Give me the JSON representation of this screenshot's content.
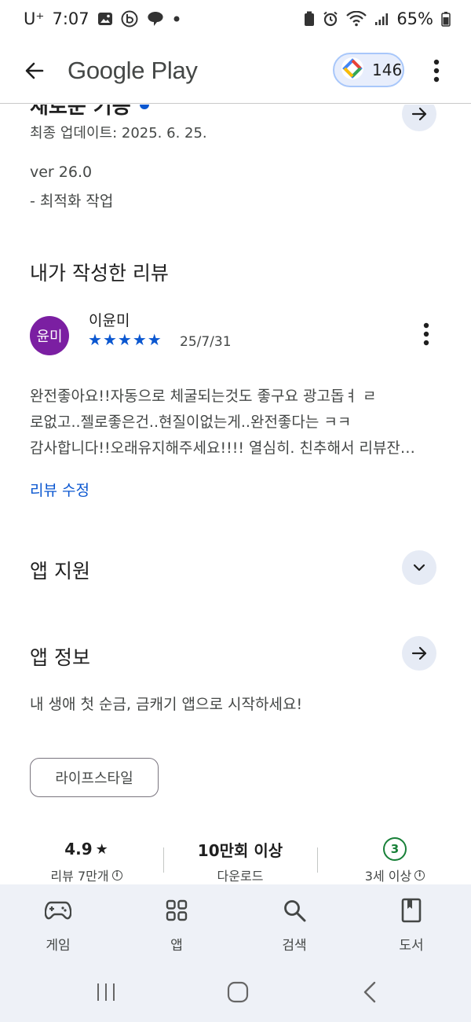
{
  "status_bar": {
    "carrier": "U⁺",
    "time": "7:07",
    "battery": "65%"
  },
  "app_bar": {
    "title": "Google Play",
    "points": "146"
  },
  "whats_new": {
    "title_partial": "새로운 기능",
    "last_updated": "최종 업데이트: 2025. 6. 25.",
    "version": "ver 26.0",
    "note": "- 최적화 작업"
  },
  "my_review": {
    "section_title": "내가 작성한 리뷰",
    "avatar_initials": "윤미",
    "reviewer_name": "이윤미",
    "rating": 5,
    "date": "25/7/31",
    "text_lines": [
      "완전좋아요!!자동으로 체굴되는것도 좋구요 광고돕ㅕ ㄹ",
      "로없고..젤로좋은건..현질이없는게..완전좋다는 ㅋㅋ",
      "감사합니다!!오래유지해주세요!!!! 열심히. 친추해서 리뷰잔…"
    ],
    "edit_label": "리뷰 수정"
  },
  "app_support": {
    "title": "앱 지원"
  },
  "app_info": {
    "title": "앱 정보",
    "tagline": "내 생애 첫 순금, 금캐기 앱으로 시작하세요!",
    "category": "라이프스타일"
  },
  "stats": {
    "rating": "4.9",
    "rating_label": "리뷰 7만개",
    "downloads": "10만회 이상",
    "downloads_label": "다운로드",
    "age_badge": "3",
    "age_label": "3세 이상"
  },
  "bottom_nav": {
    "items": [
      {
        "label": "게임",
        "icon": "gamepad-icon"
      },
      {
        "label": "앱",
        "icon": "apps-grid-icon"
      },
      {
        "label": "검색",
        "icon": "search-icon"
      },
      {
        "label": "도서",
        "icon": "book-icon"
      }
    ]
  },
  "colors": {
    "accent": "#0b57d0",
    "avatar": "#7b1fa2",
    "age_green": "#188038",
    "nav_bg": "#eef1f7"
  }
}
